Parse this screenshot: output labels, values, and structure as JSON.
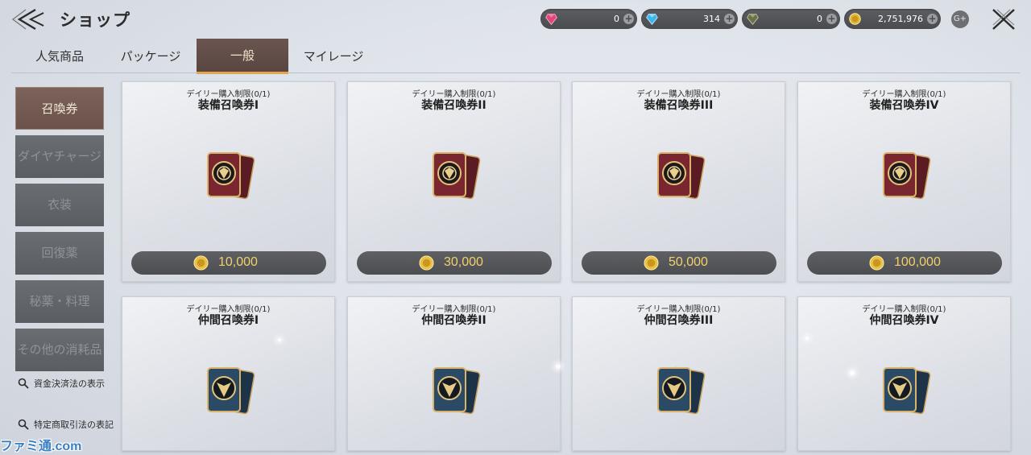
{
  "header": {
    "title": "ショップ"
  },
  "currencies": [
    {
      "name": "red-gem",
      "amount": "0",
      "color": "#e0467a"
    },
    {
      "name": "blue-gem",
      "amount": "314",
      "color": "#3fb6ea"
    },
    {
      "name": "dark-gem",
      "amount": "0",
      "color": "#6d7048"
    },
    {
      "name": "gold-coin",
      "amount": "2,751,976",
      "color": "#e2b83a"
    }
  ],
  "gplus_label": "G+",
  "tabs": [
    {
      "label": "人気商品",
      "active": false
    },
    {
      "label": "パッケージ",
      "active": false
    },
    {
      "label": "一般",
      "active": true
    },
    {
      "label": "マイレージ",
      "active": false
    }
  ],
  "sidebar": {
    "items": [
      {
        "label": "召喚券",
        "active": true
      },
      {
        "label": "ダイヤチャージ",
        "active": false
      },
      {
        "label": "衣装",
        "active": false
      },
      {
        "label": "回復薬",
        "active": false
      },
      {
        "label": "秘薬・料理",
        "active": false
      },
      {
        "label": "その他の消耗品",
        "active": false
      }
    ],
    "links": [
      {
        "label": "資金決済法の表示"
      },
      {
        "label": "特定商取引法の表記"
      }
    ]
  },
  "products": [
    {
      "limit": "デイリー購入制限(0/1)",
      "name": "装備召喚券I",
      "price": "10,000",
      "kind": "equipment-ticket-icon"
    },
    {
      "limit": "デイリー購入制限(0/1)",
      "name": "装備召喚券II",
      "price": "30,000",
      "kind": "equipment-ticket-icon"
    },
    {
      "limit": "デイリー購入制限(0/1)",
      "name": "装備召喚券III",
      "price": "50,000",
      "kind": "equipment-ticket-icon"
    },
    {
      "limit": "デイリー購入制限(0/1)",
      "name": "装備召喚券IV",
      "price": "100,000",
      "kind": "equipment-ticket-icon"
    },
    {
      "limit": "デイリー購入制限(0/1)",
      "name": "仲間召喚券I",
      "kind": "companion-ticket-icon"
    },
    {
      "limit": "デイリー購入制限(0/1)",
      "name": "仲間召喚券II",
      "kind": "companion-ticket-icon"
    },
    {
      "limit": "デイリー購入制限(0/1)",
      "name": "仲間召喚券III",
      "kind": "companion-ticket-icon"
    },
    {
      "limit": "デイリー購入制限(0/1)",
      "name": "仲間召喚券IV",
      "kind": "companion-ticket-icon"
    }
  ],
  "watermark": "ファミ通.com"
}
